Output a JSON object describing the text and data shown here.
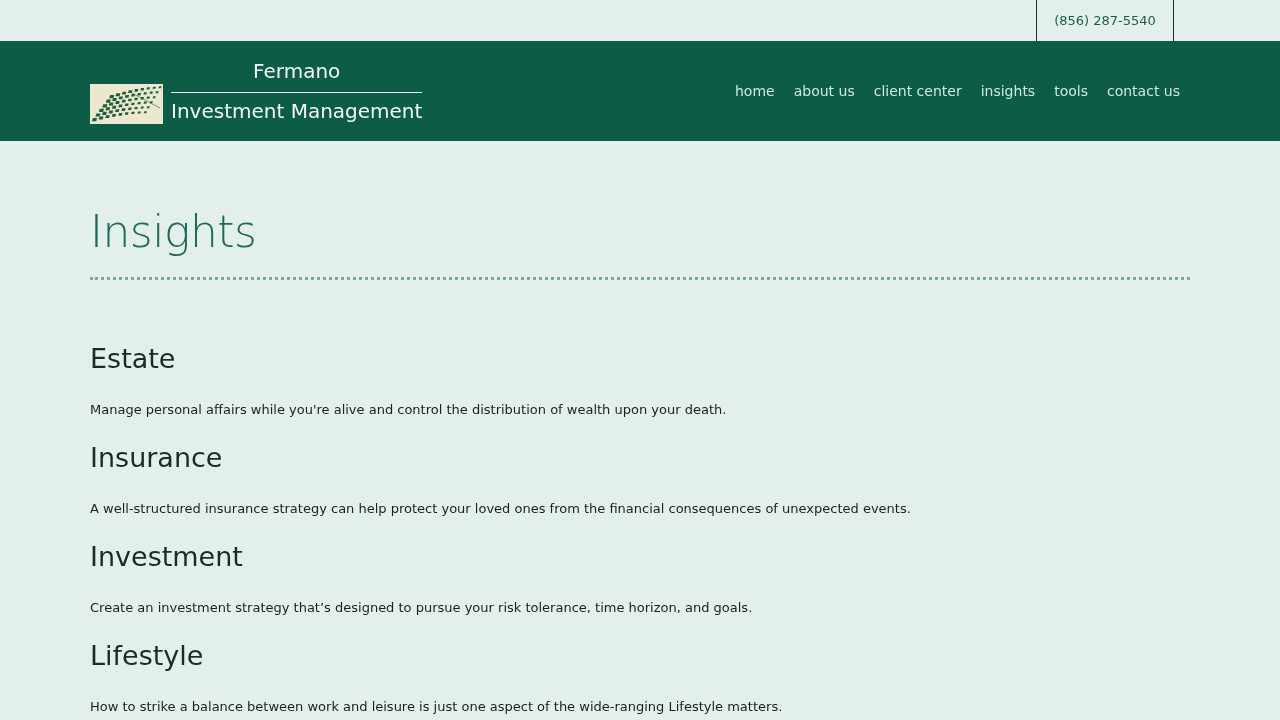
{
  "top_bar": {
    "phone": "(856) 287-5540"
  },
  "header": {
    "brand": {
      "name": "Fermano",
      "tagline": "Investment Management"
    },
    "nav": [
      "home",
      "about us",
      "client center",
      "insights",
      "tools",
      "contact us"
    ]
  },
  "page": {
    "title": "Insights",
    "sections": [
      {
        "heading": "Estate",
        "text": "Manage personal affairs while you're alive and control the distribution of wealth upon your death."
      },
      {
        "heading": "Insurance",
        "text": "A well-structured insurance strategy can help protect your loved ones from the financial consequences of unexpected events."
      },
      {
        "heading": "Investment",
        "text": "Create an investment strategy that’s designed to pursue your risk tolerance, time horizon, and goals."
      },
      {
        "heading": "Lifestyle",
        "text": "How to strike a balance between work and leisure is just one aspect of the wide-ranging Lifestyle matters."
      }
    ]
  }
}
